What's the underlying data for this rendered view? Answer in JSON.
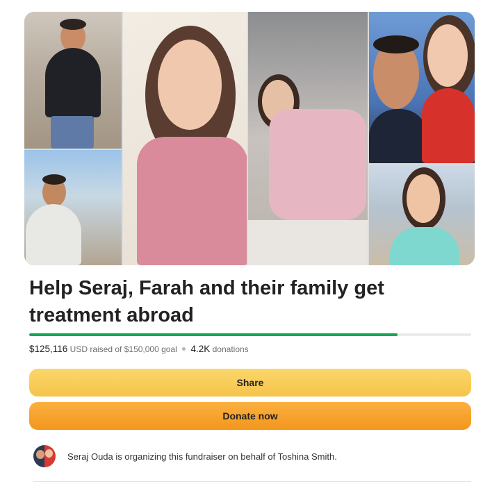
{
  "hero": {
    "photos": [
      {
        "name": "seraj-standing-rubble"
      },
      {
        "name": "seraj-rubble-smiling"
      },
      {
        "name": "farah-portrait"
      },
      {
        "name": "farah-hospital-bed"
      },
      {
        "name": "seraj-farah-selfie"
      },
      {
        "name": "farah-beach"
      }
    ]
  },
  "campaign": {
    "title": "Help Seraj, Farah and their family get treatment abroad",
    "raised_amount": "$125,116",
    "currency": "USD",
    "raised_text": "raised of",
    "goal_amount": "$150,000",
    "goal_text": "goal",
    "donations_count": "4.2K",
    "donations_label": "donations",
    "progress_fraction": 0.834
  },
  "actions": {
    "share_label": "Share",
    "donate_label": "Donate now"
  },
  "organizer": {
    "text": "Seraj Ouda is organizing this fundraiser on behalf of Toshina Smith."
  },
  "colors": {
    "progress": "#14a859",
    "share_button": "#f9cf5a",
    "donate_button": "#f7a32e"
  }
}
